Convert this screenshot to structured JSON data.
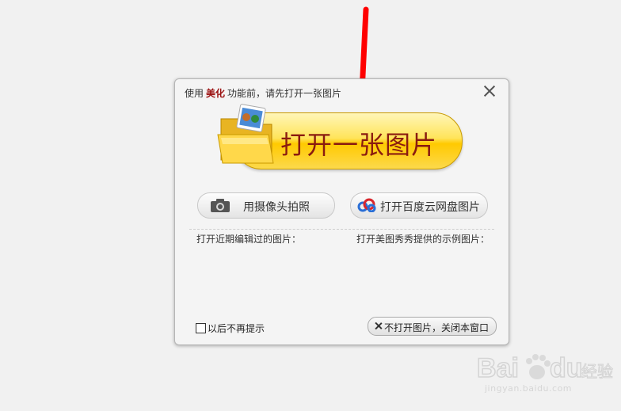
{
  "dialog": {
    "hint_prefix": "使用",
    "hint_highlight": "美化",
    "hint_suffix": "功能前，请先打开一张图片",
    "open_image_label": "打开一张图片",
    "camera_label": "用摄像头拍照",
    "cloud_label": "打开百度云网盘图片",
    "recent_label": "打开近期编辑过的图片：",
    "examples_label": "打开美图秀秀提供的示例图片：",
    "no_remind_label": "以后不再提示",
    "no_remind_checked": false,
    "no_open_label": "不打开图片，关闭本窗口"
  },
  "watermark": {
    "brand": "Bai du 经验",
    "url": "jingyan.baidu.com"
  },
  "colors": {
    "arrow": "#ff0000",
    "highlight": "#9b1010",
    "button_yellow": "#ffc900",
    "button_text": "#8a1b10"
  },
  "icons": [
    "red-arrow",
    "close-icon",
    "folder-icon",
    "camera-icon",
    "cloud-icon",
    "x-icon",
    "paw-icon"
  ]
}
